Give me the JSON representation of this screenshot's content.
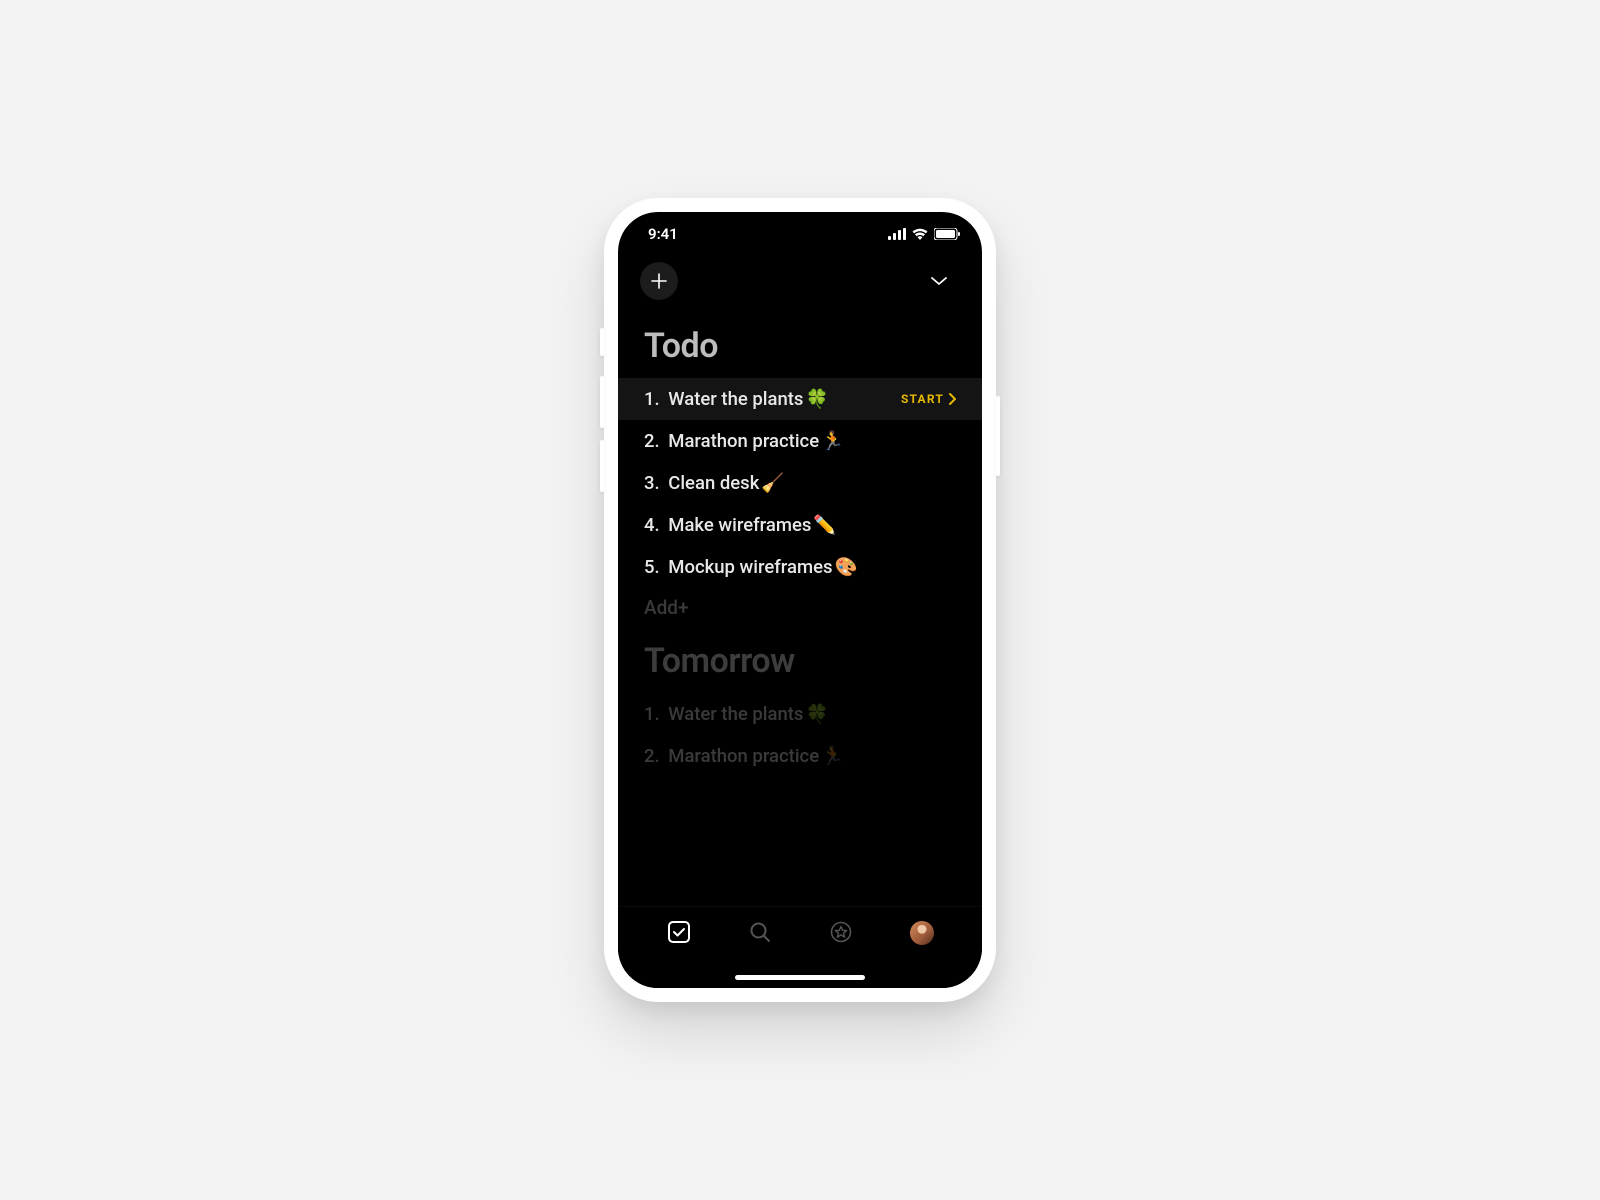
{
  "status_bar": {
    "time": "9:41"
  },
  "header": {
    "add_button_label": "+",
    "chevron": "chevron-down-icon"
  },
  "sections": {
    "today": {
      "title": "Todo",
      "add_label": "Add+",
      "start_label": "START",
      "items": [
        {
          "num": "1.",
          "text": "Water the plants",
          "emoji": "🍀"
        },
        {
          "num": "2.",
          "text": "Marathon practice",
          "emoji": "🏃"
        },
        {
          "num": "3.",
          "text": "Clean desk",
          "emoji": "🧹"
        },
        {
          "num": "4.",
          "text": "Make wireframes",
          "emoji": "✏️"
        },
        {
          "num": "5.",
          "text": "Mockup wireframes",
          "emoji": "🎨"
        }
      ]
    },
    "tomorrow": {
      "title": "Tomorrow",
      "items": [
        {
          "num": "1.",
          "text": "Water the plants",
          "emoji": "🍀"
        },
        {
          "num": "2.",
          "text": "Marathon practice",
          "emoji": "🏃"
        }
      ]
    }
  },
  "tabbar": {
    "items": [
      {
        "name": "tab-tasks",
        "icon": "checkbox-icon",
        "active": true
      },
      {
        "name": "tab-search",
        "icon": "search-icon",
        "active": false
      },
      {
        "name": "tab-favorites",
        "icon": "star-icon",
        "active": false
      },
      {
        "name": "tab-profile",
        "icon": "avatar",
        "active": false
      }
    ]
  },
  "colors": {
    "accent": "#e6b800",
    "bg": "#000000",
    "title_muted": "#bdbdbd",
    "dim_text": "#3a3a3a",
    "row_selected": "#141414"
  }
}
